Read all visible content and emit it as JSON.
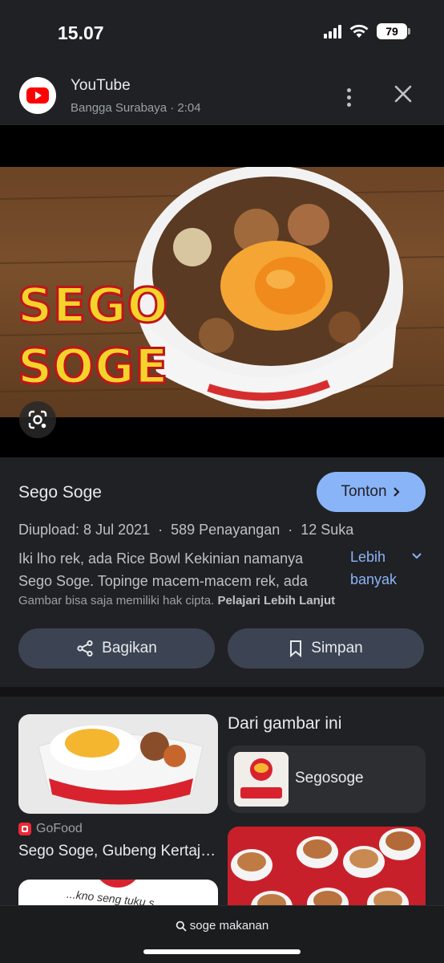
{
  "status": {
    "time": "15.07",
    "battery": "79"
  },
  "header": {
    "app_name": "YouTube",
    "subtitle": "Bangga Surabaya · 2:04",
    "icons": {
      "logo": "youtube-logo-icon",
      "more": "more-vert-icon",
      "close": "close-icon"
    }
  },
  "thumbnail": {
    "line1": "SEGO",
    "line2": "SOGE",
    "lens_icon": "google-lens-icon"
  },
  "info": {
    "title": "Sego Soge",
    "watch_label": "Tonton",
    "meta": "Diupload: 8 Jul 2021  ·  589 Penayangan  ·  12 Suka",
    "desc_line1": "Iki lho rek, ada Rice Bowl Kekinian namanya",
    "desc_line2": "Sego Soge. Topinge macem-macem rek, ada",
    "more_label": "Lebih banyak",
    "copyright_text": "Gambar bisa saja memiliki hak cipta.",
    "copyright_link": "Pelajari Lebih Lanjut",
    "share_label": "Bagikan",
    "save_label": "Simpan"
  },
  "related": {
    "source": "GoFood",
    "card_title": "Sego Soge, Gubeng Kertajaya",
    "card2_text": "...kno seng tuku s...",
    "from_image_heading": "Dari gambar ini",
    "entity_label": "Segosoge"
  },
  "bottom": {
    "query": "soge makanan"
  },
  "colors": {
    "background": "#202124",
    "accent": "#8ab4f8",
    "button_dark": "#3c4453",
    "brand_red": "#ff0000"
  }
}
